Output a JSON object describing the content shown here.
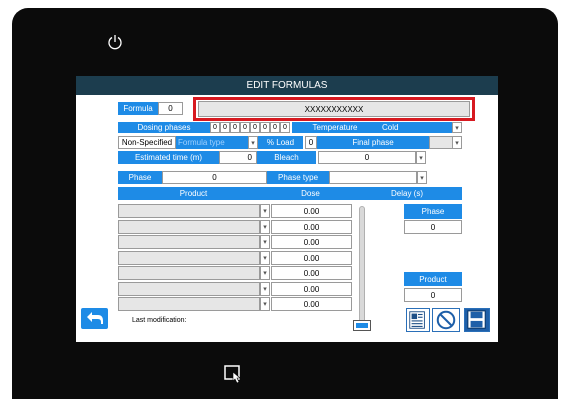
{
  "screen": {
    "title": "EDIT FORMULAS"
  },
  "formula": {
    "label": "Formula",
    "number": "0",
    "name": "XXXXXXXXXXX"
  },
  "dosing": {
    "label": "Dosing phases",
    "digits": [
      "0",
      "0",
      "0",
      "0",
      "0",
      "0",
      "0",
      "0"
    ]
  },
  "temperature": {
    "label": "Temperature",
    "value": "Cold"
  },
  "nonspecified": {
    "label": "Non-Specified",
    "type_value": "Formula type"
  },
  "load": {
    "label": "% Load",
    "value": "0"
  },
  "final_phase": {
    "label": "Final phase"
  },
  "est_time": {
    "label": "Estimated time (m)",
    "value": "0"
  },
  "bleach": {
    "label": "Bleach",
    "value": "0"
  },
  "phase": {
    "label": "Phase",
    "value": "0",
    "type_label": "Phase type"
  },
  "table": {
    "headers": [
      "Product",
      "Dose",
      "Delay (s)"
    ],
    "rows": [
      {
        "dose": "0.00"
      },
      {
        "dose": "0.00"
      },
      {
        "dose": "0.00"
      },
      {
        "dose": "0.00"
      },
      {
        "dose": "0.00"
      },
      {
        "dose": "0.00"
      },
      {
        "dose": "0.00"
      }
    ]
  },
  "side_panel": {
    "phase_label": "Phase",
    "phase_value": "0",
    "product_label": "Product",
    "product_value": "0"
  },
  "footer": {
    "last_modification": "Last modification:"
  },
  "colors": {
    "accent": "#1e8be6",
    "title_bar": "#1c3d4e",
    "highlight": "#d71920"
  }
}
